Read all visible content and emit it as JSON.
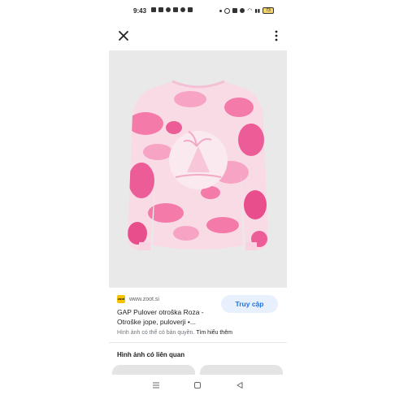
{
  "status": {
    "time": "9:43",
    "battery": "73"
  },
  "result": {
    "domain": "www.zoot.si",
    "favicon_text": "zoot",
    "title": "GAP Pulover otroška Roza - Otroške jope, puloverji •...",
    "visit_label": "Truy cập",
    "copyright_text": "Hình ảnh có thể có bản quyền.",
    "learn_more": "Tìm hiểu thêm"
  },
  "related": {
    "heading": "Hình ảnh có liên quan"
  },
  "colors": {
    "accent": "#1a73e8",
    "visit_bg": "#e8f0fe",
    "sweater_pink": "#f06ea3"
  },
  "icons": [
    "close-icon",
    "more-vert-icon",
    "menu-nav-icon",
    "home-nav-icon",
    "back-nav-icon"
  ]
}
